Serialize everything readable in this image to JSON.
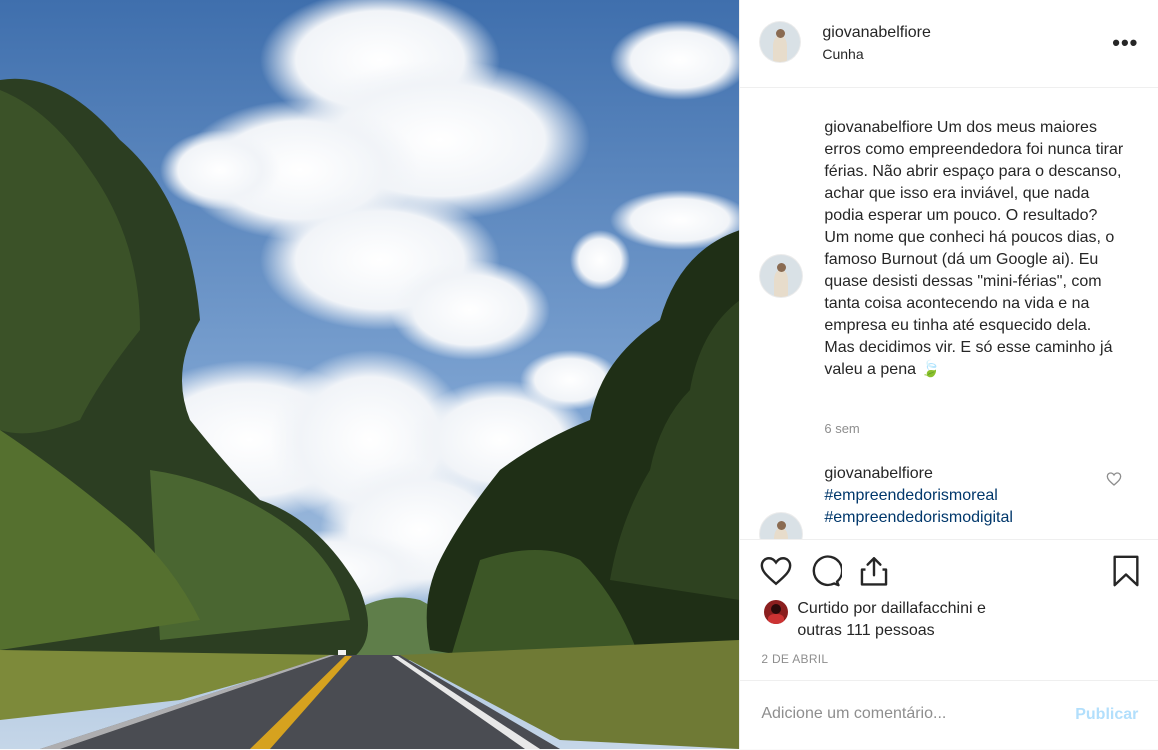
{
  "header": {
    "username": "giovanabelfiore",
    "location": "Cunha",
    "more_label": "•••"
  },
  "caption": {
    "username": "giovanabelfiore",
    "text": "Um dos meus maiores erros como empreendedora foi nunca tirar férias. Não abrir espaço para o descanso, achar que isso era inviável, que nada podia esperar um pouco. O resultado? Um nome que conheci há poucos dias, o famoso Burnout (dá um Google ai). Eu quase desisti dessas \"mini-férias\", com tanta coisa acontecendo na vida e na empresa eu tinha até esquecido dela. Mas decidimos vir. E só esse caminho já valeu a pena 🍃",
    "time": "6 sem"
  },
  "comment2": {
    "username": "giovanabelfiore",
    "hashtags": [
      "#empreendedorismoreal",
      "#empreendedorismodigital"
    ]
  },
  "likes": {
    "prefix": "Curtido por ",
    "user": "daillafacchini",
    "conj": " e",
    "others": "outras 111 pessoas"
  },
  "date": "2 DE ABRIL",
  "add_comment": {
    "placeholder": "Adicione um comentário...",
    "publish_label": "Publicar"
  },
  "icons": {
    "more": "more-options-icon",
    "like": "heart-icon",
    "comment": "comment-bubble-icon",
    "share": "share-icon",
    "save": "bookmark-icon"
  },
  "colors": {
    "hashtag": "#00376b",
    "muted": "#8e8e8e",
    "publish_disabled": "#b2dffc"
  }
}
